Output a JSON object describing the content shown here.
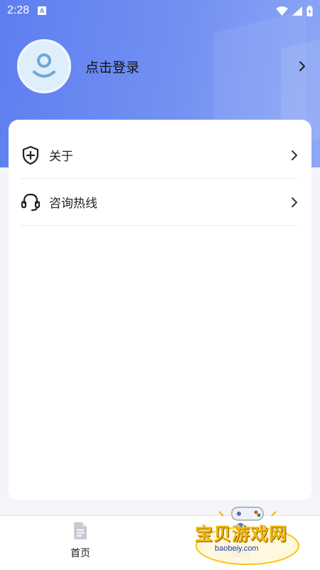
{
  "status_bar": {
    "time": "2:28",
    "notification_icon": "a-icon",
    "icons": [
      "wifi-icon",
      "signal-icon",
      "battery-icon"
    ]
  },
  "profile": {
    "login_label": "点击登录",
    "avatar_icon": "user-face-icon",
    "chevron_icon": "chevron-right-icon"
  },
  "menu": {
    "items": [
      {
        "label": "关于",
        "icon": "shield-plus-icon"
      },
      {
        "label": "咨询热线",
        "icon": "headset-icon"
      }
    ]
  },
  "tabbar": {
    "tabs": [
      {
        "label": "首页",
        "icon": "document-icon",
        "active": false
      },
      {
        "label": "我的",
        "icon": "person-icon",
        "active": true
      }
    ]
  },
  "watermark": {
    "title": "宝贝游戏网",
    "url": "baobeiy.com"
  },
  "colors": {
    "header_gradient_start": "#5d7ef0",
    "header_gradient_end": "#8ea8f6",
    "page_background": "#f3f5f9",
    "active_tab": "#4f73e8"
  }
}
